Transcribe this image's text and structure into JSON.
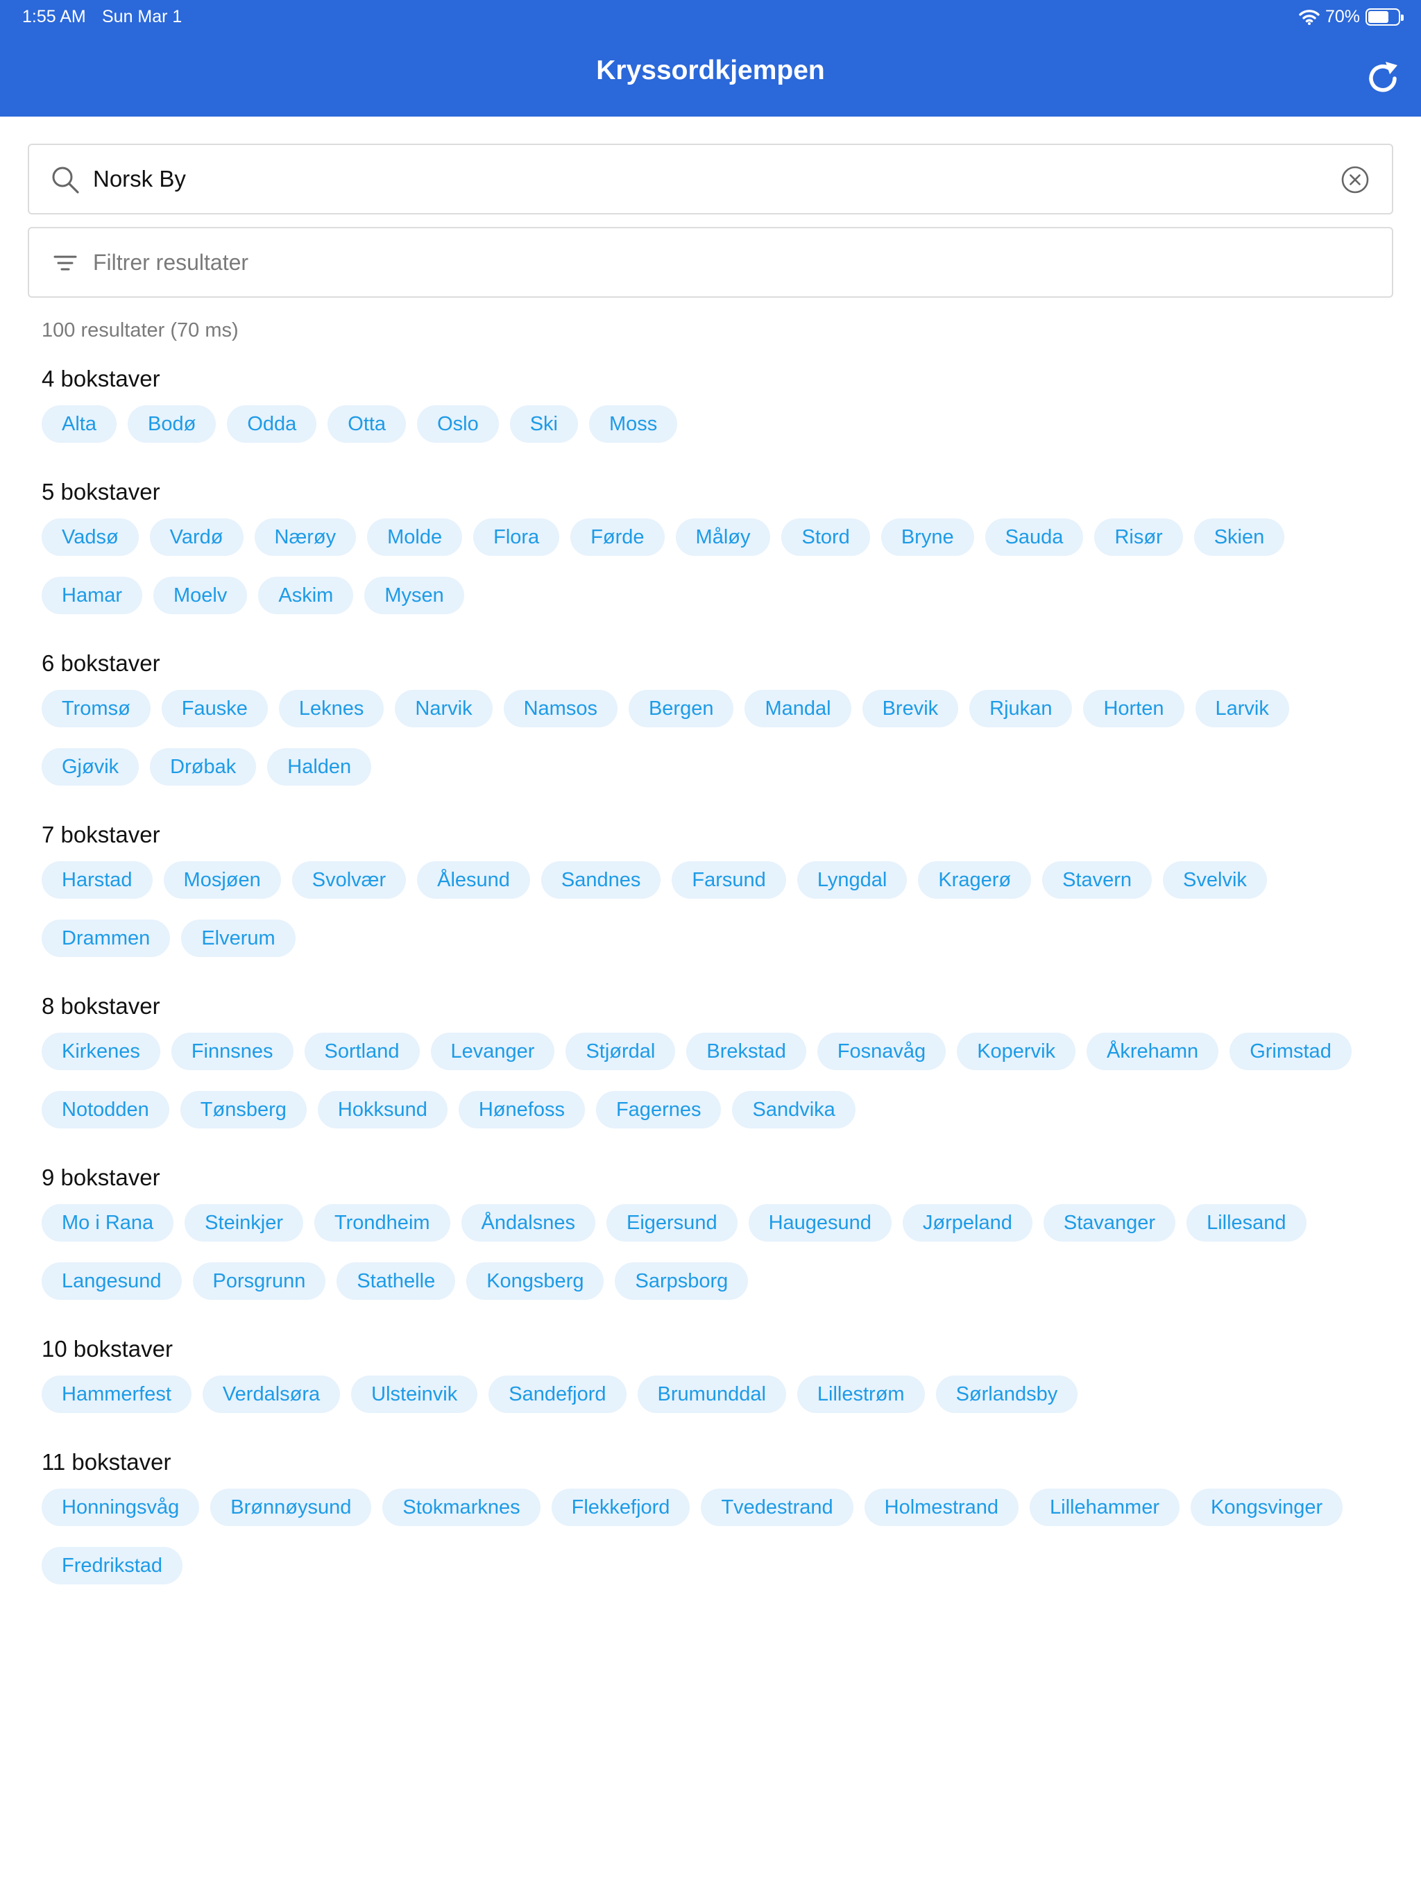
{
  "status": {
    "time": "1:55 AM",
    "date": "Sun Mar 1",
    "battery": "70%",
    "battery_level": 0.7
  },
  "app": {
    "title": "Kryssordkjempen"
  },
  "icons": {
    "refresh": "refresh-icon",
    "search": "search-icon",
    "clear": "clear-circle-icon",
    "filter": "filter-icon",
    "wifi": "wifi-icon",
    "battery": "battery-icon"
  },
  "colors": {
    "header": "#2b68d9",
    "chip_bg": "#e6f2fc",
    "chip_text": "#1d9be6"
  },
  "search": {
    "value": "Norsk By"
  },
  "filter": {
    "placeholder": "Filtrer resultater"
  },
  "results": {
    "summary": "100 resultater (70 ms)"
  },
  "groups": [
    {
      "title": "4 bokstaver",
      "items": [
        "Alta",
        "Bodø",
        "Odda",
        "Otta",
        "Oslo",
        "Ski",
        "Moss"
      ]
    },
    {
      "title": "5 bokstaver",
      "items": [
        "Vadsø",
        "Vardø",
        "Nærøy",
        "Molde",
        "Flora",
        "Førde",
        "Måløy",
        "Stord",
        "Bryne",
        "Sauda",
        "Risør",
        "Skien",
        "Hamar",
        "Moelv",
        "Askim",
        "Mysen"
      ]
    },
    {
      "title": "6 bokstaver",
      "items": [
        "Tromsø",
        "Fauske",
        "Leknes",
        "Narvik",
        "Namsos",
        "Bergen",
        "Mandal",
        "Brevik",
        "Rjukan",
        "Horten",
        "Larvik",
        "Gjøvik",
        "Drøbak",
        "Halden"
      ]
    },
    {
      "title": "7 bokstaver",
      "items": [
        "Harstad",
        "Mosjøen",
        "Svolvær",
        "Ålesund",
        "Sandnes",
        "Farsund",
        "Lyngdal",
        "Kragerø",
        "Stavern",
        "Svelvik",
        "Drammen",
        "Elverum"
      ]
    },
    {
      "title": "8 bokstaver",
      "items": [
        "Kirkenes",
        "Finnsnes",
        "Sortland",
        "Levanger",
        "Stjørdal",
        "Brekstad",
        "Fosnavåg",
        "Kopervik",
        "Åkrehamn",
        "Grimstad",
        "Notodden",
        "Tønsberg",
        "Hokksund",
        "Hønefoss",
        "Fagernes",
        "Sandvika"
      ]
    },
    {
      "title": "9 bokstaver",
      "items": [
        "Mo i Rana",
        "Steinkjer",
        "Trondheim",
        "Åndalsnes",
        "Eigersund",
        "Haugesund",
        "Jørpeland",
        "Stavanger",
        "Lillesand",
        "Langesund",
        "Porsgrunn",
        "Stathelle",
        "Kongsberg",
        "Sarpsborg"
      ]
    },
    {
      "title": "10 bokstaver",
      "items": [
        "Hammerfest",
        "Verdalsøra",
        "Ulsteinvik",
        "Sandefjord",
        "Brumunddal",
        "Lillestrøm",
        "Sørlandsby"
      ]
    },
    {
      "title": "11 bokstaver",
      "items": [
        "Honningsvåg",
        "Brønnøysund",
        "Stokmarknes",
        "Flekkefjord",
        "Tvedestrand",
        "Holmestrand",
        "Lillehammer",
        "Kongsvinger",
        "Fredrikstad"
      ]
    }
  ]
}
